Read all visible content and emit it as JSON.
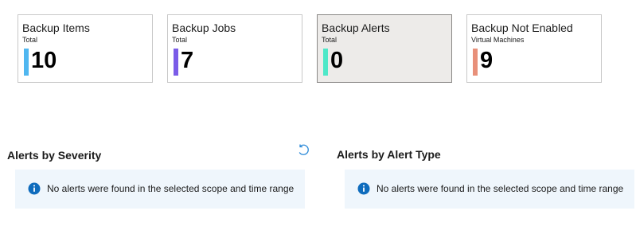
{
  "tiles": [
    {
      "title": "Backup Items",
      "subtitle": "Total",
      "value": "10",
      "accent": "#50b7f0",
      "selected": false
    },
    {
      "title": "Backup Jobs",
      "subtitle": "Total",
      "value": "7",
      "accent": "#7b5ce8",
      "selected": false
    },
    {
      "title": "Backup Alerts",
      "subtitle": "Total",
      "value": "0",
      "accent": "#4ee8c8",
      "selected": true
    },
    {
      "title": "Backup Not Enabled",
      "subtitle": "Virtual Machines",
      "value": "9",
      "accent": "#e8907a",
      "selected": false
    }
  ],
  "sections": {
    "severity": {
      "title": "Alerts by Severity",
      "message": "No alerts were found in the selected scope and time range"
    },
    "alert_type": {
      "title": "Alerts by Alert Type",
      "message": "No alerts were found in the selected scope and time range"
    }
  },
  "icons": {
    "refresh": "refresh-icon",
    "info": "info-icon"
  },
  "colors": {
    "info_icon": "#0f6cbd",
    "info_bg": "#eff6fc",
    "refresh": "#2e8bd9"
  }
}
